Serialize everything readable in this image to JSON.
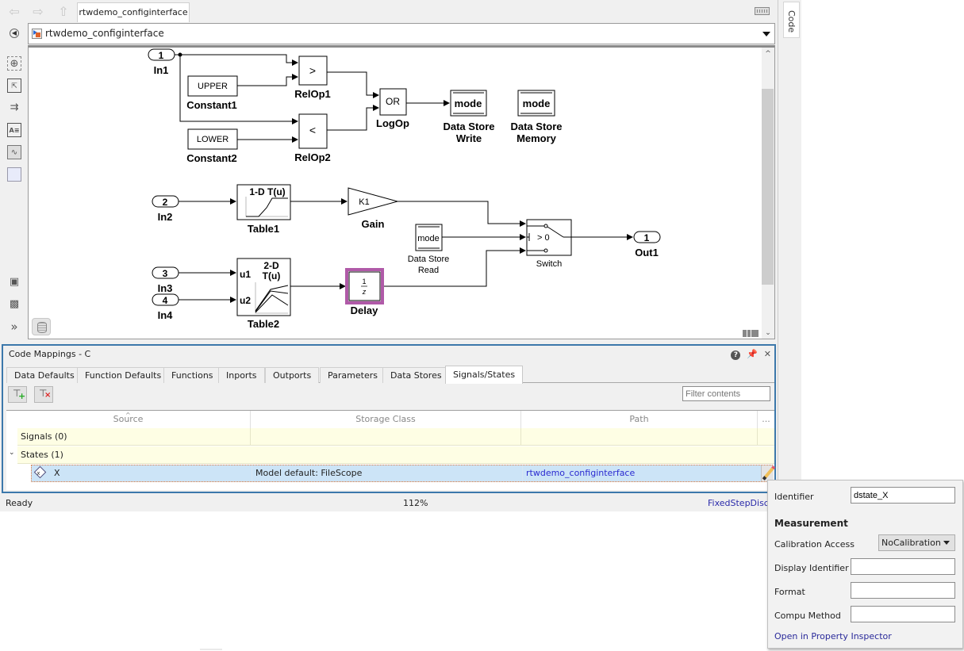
{
  "toolbar": {
    "back_icon": "arrow-left-icon",
    "forward_icon": "arrow-right-icon",
    "up_icon": "arrow-up-icon",
    "file_tab": "rtwdemo_configinterface",
    "keyboard_icon": "keyboard-icon"
  },
  "side_tab": {
    "label": "Code"
  },
  "address_bar": {
    "path": "rtwdemo_configinterface"
  },
  "palette": [
    "zoom-in-icon",
    "fit-to-view-icon",
    "route-lines-icon",
    "annotation-icon",
    "image-icon",
    "area-icon",
    "screenshot-icon",
    "model-browser-icon",
    "more-icon"
  ],
  "diagram": {
    "blocks": {
      "in1": {
        "port": "1",
        "name": "In1"
      },
      "const1": {
        "value": "UPPER",
        "name": "Constant1"
      },
      "const2": {
        "value": "LOWER",
        "name": "Constant2"
      },
      "relop1": {
        "op": ">",
        "name": "RelOp1"
      },
      "relop2": {
        "op": "<",
        "name": "RelOp2"
      },
      "logop": {
        "op": "OR",
        "name": "LogOp"
      },
      "dsw": {
        "store": "mode",
        "name1": "Data Store",
        "name2": "Write"
      },
      "dsm": {
        "store": "mode",
        "name1": "Data Store",
        "name2": "Memory"
      },
      "in2": {
        "port": "2",
        "name": "In2"
      },
      "table1": {
        "title": "1-D T(u)",
        "name": "Table1"
      },
      "gain": {
        "value": "K1",
        "name": "Gain"
      },
      "dsr": {
        "store": "mode",
        "name1": "Data Store",
        "name2": "Read"
      },
      "switch": {
        "cond": "> 0",
        "name": "Switch"
      },
      "out1": {
        "port": "1",
        "name": "Out1"
      },
      "in3": {
        "port": "3",
        "name": "In3"
      },
      "in4": {
        "port": "4",
        "name": "In4"
      },
      "table2": {
        "title1": "2-D",
        "title2": "T(u)",
        "u1": "u1",
        "u2": "u2",
        "name": "Table2"
      },
      "delay": {
        "num": "1",
        "den": "z",
        "name": "Delay"
      }
    }
  },
  "code_mappings": {
    "title": "Code Mappings - C",
    "tabs": [
      "Data Defaults",
      "Function Defaults",
      "Functions",
      "Inports",
      "Outports",
      "Parameters",
      "Data Stores",
      "Signals/States"
    ],
    "active_tab": "Signals/States",
    "add_button_icon": "add-signal-icon",
    "remove_button_icon": "remove-signal-icon",
    "filter_placeholder": "Filter contents",
    "columns": [
      "Source",
      "Storage Class",
      "Path",
      "..."
    ],
    "groups": [
      {
        "label": "Signals (0)",
        "expanded": false
      },
      {
        "label": "States (1)",
        "expanded": true
      }
    ],
    "rows": [
      {
        "source": "X",
        "storage_class": "Model default: FileScope",
        "path": "rtwdemo_configinterface"
      }
    ]
  },
  "status": {
    "left": "Ready",
    "zoom": "112%",
    "solver": "FixedStepDiscrete"
  },
  "popup": {
    "identifier_label": "Identifier",
    "identifier_value": "dstate_X",
    "section": "Measurement",
    "calibration_label": "Calibration Access",
    "calibration_value": "NoCalibration",
    "display_identifier_label": "Display Identifier",
    "display_identifier_value": "",
    "format_label": "Format",
    "format_value": "",
    "compu_method_label": "Compu Method",
    "compu_method_value": "",
    "link": "Open in Property Inspector"
  },
  "colors": {
    "panel_border": "#3c78ab",
    "selected_row": "#cce4f7",
    "group_row": "#fefee4",
    "delay_highlight": "#b05aa8",
    "link": "#2a2ad0"
  }
}
